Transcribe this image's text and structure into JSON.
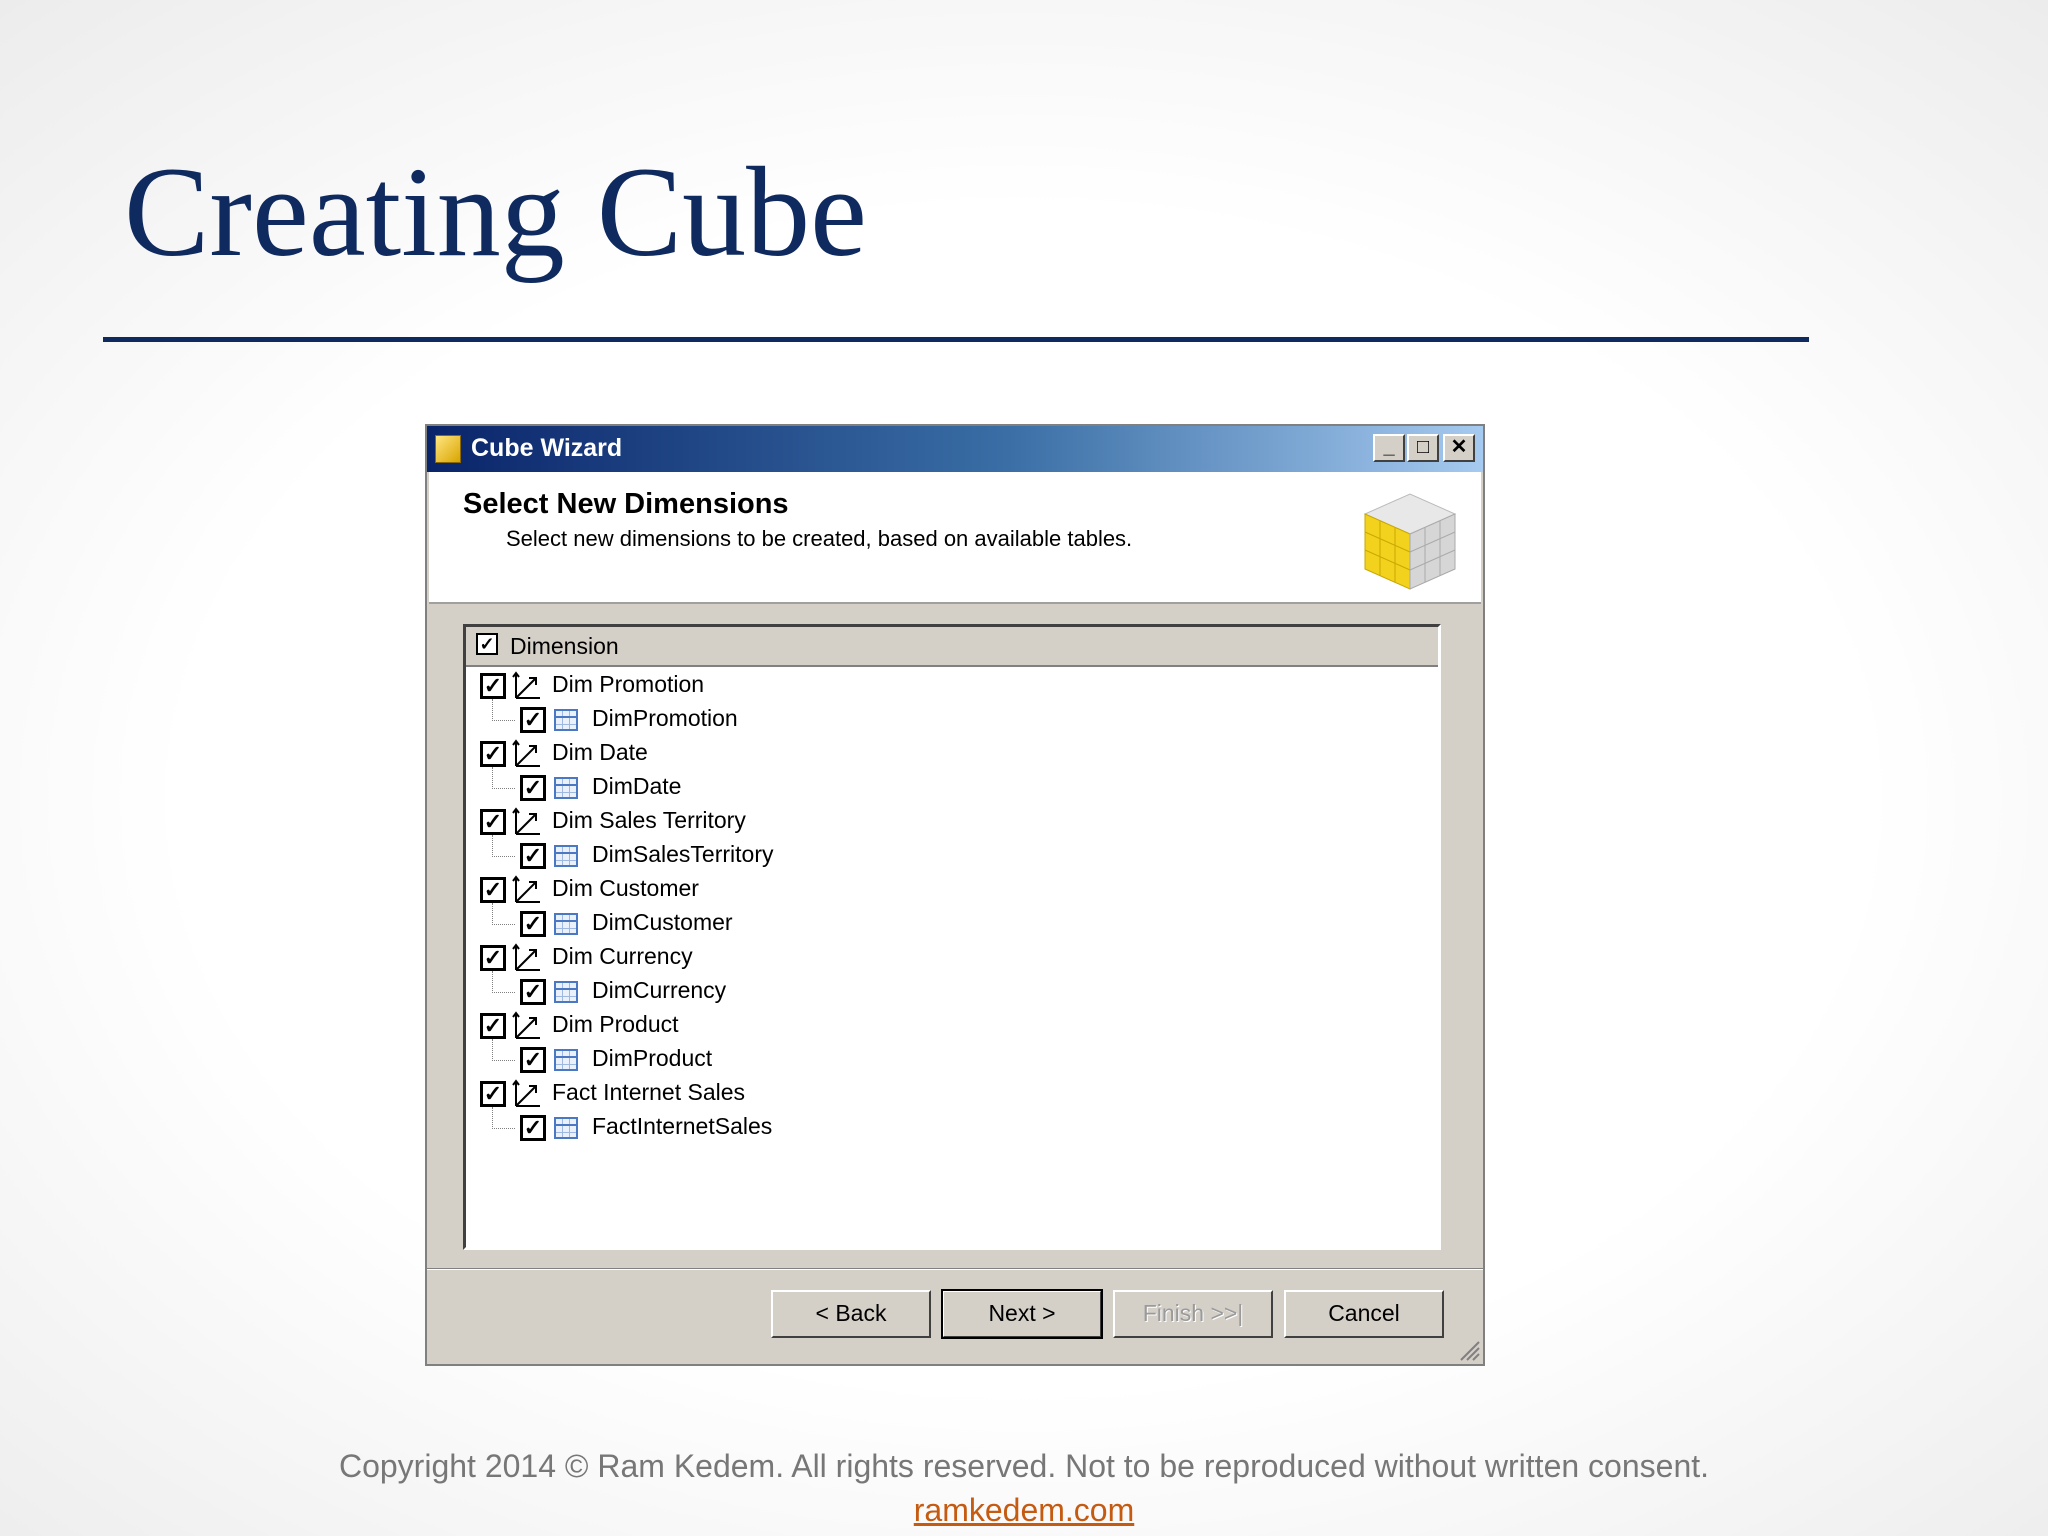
{
  "slide": {
    "title": "Creating Cube",
    "footer_copyright": "Copyright 2014 © Ram Kedem. All rights reserved. Not to be reproduced without written consent.",
    "footer_link": "ramkedem.com"
  },
  "dialog": {
    "title": "Cube Wizard",
    "caption_buttons": {
      "minimize": "_",
      "maximize": "□",
      "close": "✕"
    },
    "header": {
      "title": "Select New Dimensions",
      "subtitle": "Select new dimensions to be created, based on available tables."
    },
    "list": {
      "column_header": "Dimension",
      "header_checked": true,
      "items": [
        {
          "dimension": "Dim Promotion",
          "table": "DimPromotion",
          "checked": true
        },
        {
          "dimension": "Dim Date",
          "table": "DimDate",
          "checked": true
        },
        {
          "dimension": "Dim Sales Territory",
          "table": "DimSalesTerritory",
          "checked": true
        },
        {
          "dimension": "Dim Customer",
          "table": "DimCustomer",
          "checked": true
        },
        {
          "dimension": "Dim Currency",
          "table": "DimCurrency",
          "checked": true
        },
        {
          "dimension": "Dim Product",
          "table": "DimProduct",
          "checked": true
        },
        {
          "dimension": "Fact Internet Sales",
          "table": "FactInternetSales",
          "checked": true
        }
      ]
    },
    "buttons": {
      "back": "< Back",
      "next": "Next >",
      "finish": "Finish >>|",
      "cancel": "Cancel"
    }
  },
  "colors": {
    "title_navy": "#0f2a5e",
    "dialog_gray": "#d4d0c8",
    "link_orange": "#c55a11"
  }
}
